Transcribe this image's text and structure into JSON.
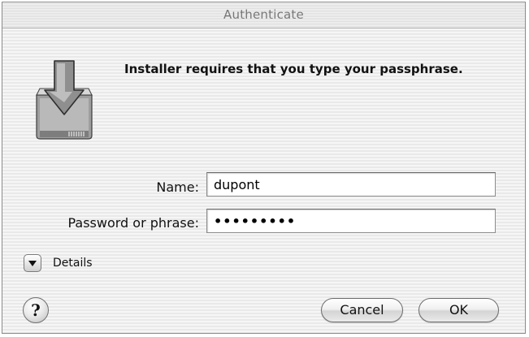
{
  "window": {
    "title": "Authenticate"
  },
  "icon": {
    "name": "installer-icon"
  },
  "message": "Installer requires that you type your passphrase.",
  "form": {
    "name_label": "Name:",
    "name_value": "dupont",
    "password_label": "Password or phrase:",
    "password_value": "•••••••••"
  },
  "details": {
    "label": "Details",
    "icon": "disclosure-triangle-icon"
  },
  "buttons": {
    "help_label": "?",
    "cancel_label": "Cancel",
    "ok_label": "OK"
  },
  "colors": {
    "title_text": "#777777",
    "background_stripe_light": "#f6f6f6",
    "background_stripe_dark": "#e9e9e9"
  }
}
